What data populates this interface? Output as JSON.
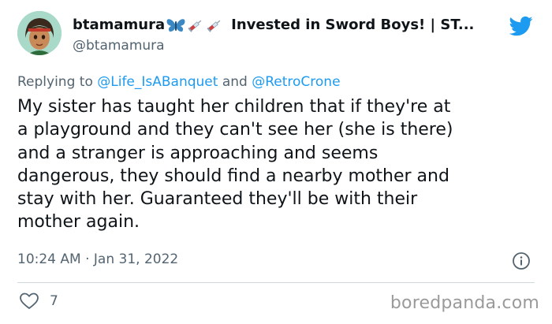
{
  "tweet": {
    "display_name": "btamamura",
    "display_name_suffix": "Invested in Sword Boys! | ST...",
    "handle": "@btamamura",
    "replying_prefix": "Replying to",
    "replying_mention_1": "@Life_IsABanquet",
    "replying_and": "and",
    "replying_mention_2": "@RetroCrone",
    "text": "My sister has taught her children that if they're at\na playground and they can't see her (she is there)\nand a stranger is approaching and seems\ndangerous, they should find a nearby mother and\nstay with her. Guaranteed they'll be with their\nmother again.",
    "timestamp": "10:24 AM · Jan 31, 2022",
    "like_count": "7"
  },
  "watermark": "boredpanda.com",
  "colors": {
    "twitter_blue": "#1d9bf0",
    "butterfly_blue": "#3b88c3",
    "secondary_text": "#536471",
    "divider": "#cfd9de"
  },
  "icons": {
    "verified_emoji_1": "butterfly-icon",
    "verified_emoji_2": "syringe-icon",
    "brand": "twitter-bird-icon",
    "info": "info-icon",
    "like": "heart-icon"
  }
}
